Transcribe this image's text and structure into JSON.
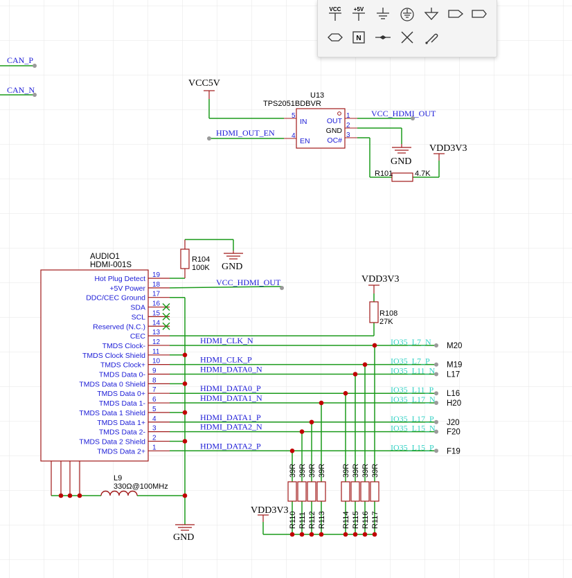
{
  "colors": {
    "wire": "#1a9a1a",
    "part": "#a01818",
    "pin": "#a01818",
    "junction": "#c00000",
    "netlabel": "#1b1bd6",
    "iolabel": "#33d1c4",
    "power": "#1b1bd6",
    "grid": "#e6e6e6",
    "text": "#000000"
  },
  "toolbar": {
    "items": [
      "vcc-symbol",
      "plus5v-symbol",
      "ground-symbol",
      "earth-ground-symbol",
      "analog-ground-symbol",
      "netport-right-icon",
      "netport-bidir-icon",
      "netport-hex-icon",
      "netflag-icon",
      "junction-icon",
      "no-connect-icon",
      "probe-icon"
    ],
    "vcc_label": "VCC",
    "plus5v_label": "+5V",
    "netflag_label": "N"
  },
  "offpage_nets": {
    "can_p": "CAN_P",
    "can_n": "CAN_N"
  },
  "u13": {
    "designator": "U13",
    "part": "TPS2051BDBVR",
    "pins": [
      {
        "num": "5",
        "name": "IN"
      },
      {
        "num": "4",
        "name": "EN"
      },
      {
        "num": "1",
        "name": "OUT"
      },
      {
        "num": "2",
        "name": "GND"
      },
      {
        "num": "3",
        "name": "OC#"
      }
    ],
    "supply_in": "VCC5V",
    "net_out": "VCC_HDMI_OUT",
    "net_en": "HDMI_OUT_EN",
    "gnd": "GND",
    "pullup_supply": "VDD3V3",
    "r101": "R101",
    "r101_value": "4.7K"
  },
  "r104": {
    "designator": "R104",
    "value": "100K",
    "gnd": "GND"
  },
  "r108": {
    "designator": "R108",
    "value": "27K",
    "supply": "VDD3V3"
  },
  "audio1": {
    "designator": "AUDIO1",
    "part": "HDMI-001S",
    "pins": [
      {
        "num": "19",
        "name": "Hot Plug Detect"
      },
      {
        "num": "18",
        "name": "+5V Power"
      },
      {
        "num": "17",
        "name": "DDC/CEC Ground"
      },
      {
        "num": "16",
        "name": "SDA"
      },
      {
        "num": "15",
        "name": "SCL"
      },
      {
        "num": "14",
        "name": "Reserved (N.C.)"
      },
      {
        "num": "13",
        "name": "CEC"
      },
      {
        "num": "12",
        "name": "TMDS Clock-"
      },
      {
        "num": "11",
        "name": "TMDS Clock Shield"
      },
      {
        "num": "10",
        "name": "TMDS Clock+"
      },
      {
        "num": "9",
        "name": "TMDS Data 0-"
      },
      {
        "num": "8",
        "name": "TMDS Data 0 Shield"
      },
      {
        "num": "7",
        "name": "TMDS Data 0+"
      },
      {
        "num": "6",
        "name": "TMDS Data 1-"
      },
      {
        "num": "5",
        "name": "TMDS Data 1 Shield"
      },
      {
        "num": "4",
        "name": "TMDS Data 1+"
      },
      {
        "num": "3",
        "name": "TMDS Data 2-"
      },
      {
        "num": "2",
        "name": "TMDS Data 2 Shield"
      },
      {
        "num": "1",
        "name": "TMDS Data 2+"
      }
    ],
    "power_net": "VCC_HDMI_OUT"
  },
  "signals": [
    {
      "pin": "12",
      "net": "HDMI_CLK_N",
      "io": "IO35_L7_N",
      "ball": "M20"
    },
    {
      "pin": "10",
      "net": "HDMI_CLK_P",
      "io": "IO35_L7_P",
      "ball": "M19"
    },
    {
      "pin": "9",
      "net": "HDMI_DATA0_N",
      "io": "IO35_L11_N",
      "ball": "L17"
    },
    {
      "pin": "7",
      "net": "HDMI_DATA0_P",
      "io": "IO35_L11_P",
      "ball": "L16"
    },
    {
      "pin": "6",
      "net": "HDMI_DATA1_N",
      "io": "IO35_L17_N",
      "ball": "H20"
    },
    {
      "pin": "4",
      "net": "HDMI_DATA1_P",
      "io": "IO35_L17_P",
      "ball": "J20"
    },
    {
      "pin": "3",
      "net": "HDMI_DATA2_N",
      "io": "IO35_L15_N",
      "ball": "F20"
    },
    {
      "pin": "1",
      "net": "HDMI_DATA2_P",
      "io": "IO35_L15_P",
      "ball": "F19"
    }
  ],
  "pulldowns": {
    "supply": "VDD3V3",
    "resistors": [
      {
        "designator": "R110",
        "value": "39R"
      },
      {
        "designator": "R111",
        "value": "39R"
      },
      {
        "designator": "R112",
        "value": "39R"
      },
      {
        "designator": "R113",
        "value": "39R"
      },
      {
        "designator": "R114",
        "value": "39R"
      },
      {
        "designator": "R115",
        "value": "39R"
      },
      {
        "designator": "R116",
        "value": "39R"
      },
      {
        "designator": "R117",
        "value": "39R"
      }
    ]
  },
  "l9": {
    "designator": "L9",
    "value": "330Ω@100MHz",
    "gnd": "GND"
  }
}
